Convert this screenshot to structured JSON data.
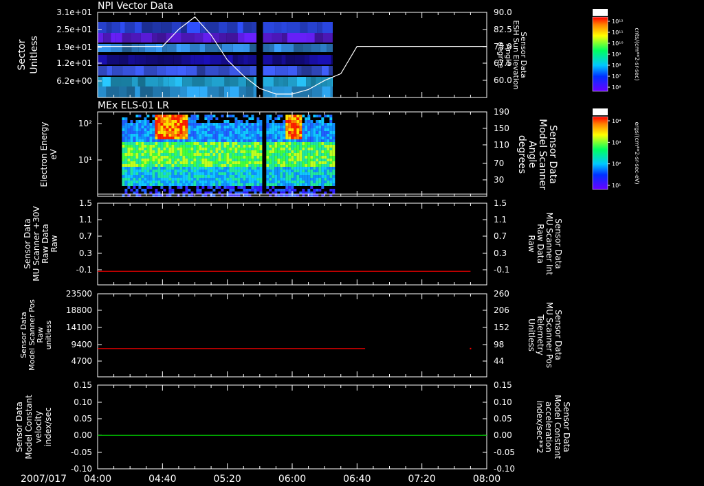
{
  "chart_data": [
    {
      "type": "heatmap",
      "title": "NPI Vector Data",
      "ylabel_left": [
        "Sector",
        "Unitless"
      ],
      "ylabel_right": [
        "Sensor Data",
        "ESH Sun Elevation",
        "Angle",
        "degree"
      ],
      "yticks_left": [
        "3.1e+01",
        "2.5e+01",
        "1.9e+01",
        "1.2e+01",
        "6.2e+00"
      ],
      "yticks_right": [
        "90.0",
        "82.5",
        "75.0",
        "67.5",
        "60.0"
      ],
      "ylim_right": [
        52.5,
        90
      ],
      "colorbar": {
        "label": "NF",
        "units": "cnts/(cm**2-sr-sec)",
        "ticks": [
          "10¹²",
          "10¹¹",
          "10¹⁰",
          "10⁹",
          "10⁸",
          "10⁷",
          "10⁶"
        ]
      },
      "overlay_line": {
        "x": [
          "04:00",
          "04:40",
          "04:50",
          "05:00",
          "05:10",
          "05:20",
          "05:30",
          "05:40",
          "05:50",
          "06:00",
          "06:10",
          "06:20",
          "06:30",
          "06:40",
          "07:00",
          "07:20",
          "07:40",
          "08:00"
        ],
        "y": [
          75.0,
          75.0,
          82.5,
          88.0,
          80.0,
          69.0,
          62.0,
          56.5,
          54.0,
          54.0,
          56.0,
          60.0,
          63.0,
          75.0,
          75.0,
          75.0,
          75.0,
          75.0
        ]
      },
      "data_gaps": [
        [
          "05:38",
          "05:42"
        ],
        [
          "06:25",
          "08:00"
        ]
      ]
    },
    {
      "type": "heatmap",
      "title": "MEx ELS-01 LR",
      "ylabel_left": [
        "Electron Energy",
        "eV"
      ],
      "ylabel_right": [
        "Sensor Data",
        "Model Scanner",
        "Angle",
        "degrees"
      ],
      "yticks_left": [
        "10²",
        "10¹"
      ],
      "yticks_right": [
        "190",
        "150",
        "110",
        "70",
        "30"
      ],
      "ylim_right": [
        0,
        190
      ],
      "colorbar": {
        "label": "DEF",
        "units": "ergs/(cm**2-sr-sec-eV)",
        "ticks": [
          "10⁴",
          "10³",
          "10²",
          "10¹"
        ]
      },
      "overlay_line": {
        "x": [
          "04:00",
          "08:00"
        ],
        "y": [
          5,
          5
        ]
      },
      "data_gaps": [
        [
          "05:40",
          "05:44"
        ],
        [
          "06:28",
          "08:00"
        ]
      ]
    },
    {
      "type": "line",
      "ylabel_left": [
        "Sensor Data",
        "MU Scanner +30V",
        "Raw Data",
        "Raw"
      ],
      "ylabel_right": [
        "Sensor Data",
        "MU Scanner Int",
        "Raw Data",
        "Raw"
      ],
      "yticks_left": [
        "1.5",
        "1.1",
        "0.7",
        "0.3",
        "-0.1"
      ],
      "yticks_right": [
        "1.5",
        "1.1",
        "0.7",
        "0.3",
        "-0.1"
      ],
      "ylim": [
        -0.3,
        1.5
      ],
      "series": [
        {
          "color": "#ff0000",
          "x": [
            "04:00",
            "07:50"
          ],
          "values": [
            0.0,
            0.0
          ]
        }
      ]
    },
    {
      "type": "line",
      "ylabel_left": [
        "Sensor Data",
        "Model Scanner Pos",
        "Raw",
        "unitless"
      ],
      "ylabel_right": [
        "Sensor Data",
        "MU Scanner Pos",
        "Telemetry",
        "Unitless"
      ],
      "yticks_left": [
        "23500",
        "18800",
        "14100",
        "9400",
        "4700"
      ],
      "yticks_right": [
        "260",
        "206",
        "152",
        "98",
        "44"
      ],
      "ylim": [
        0,
        23500
      ],
      "series": [
        {
          "color": "#ff0000",
          "x": [
            "04:00",
            "06:45"
          ],
          "values": [
            8000,
            8000
          ]
        }
      ]
    },
    {
      "type": "line",
      "ylabel_left": [
        "Sensor Data",
        "Model Constant",
        "velocity",
        "index/sec"
      ],
      "ylabel_right": [
        "Sensor Data",
        "Model Constant",
        "acceleration",
        "index/sec**2"
      ],
      "yticks_left": [
        "0.15",
        "0.10",
        "0.05",
        "0.00",
        "-0.05",
        "-0.10"
      ],
      "yticks_right": [
        "0.15",
        "0.10",
        "0.05",
        "0.00",
        "-0.05",
        "-0.10"
      ],
      "ylim": [
        -0.1,
        0.15
      ],
      "series": [
        {
          "color": "#00dd00",
          "x": [
            "04:00",
            "08:00"
          ],
          "values": [
            0.0,
            0.0
          ]
        }
      ]
    }
  ],
  "xaxis": {
    "date": "2007/017",
    "ticks": [
      "04:00",
      "04:40",
      "05:20",
      "06:00",
      "06:40",
      "07:20",
      "08:00"
    ],
    "xlim": [
      "04:00",
      "08:00"
    ]
  },
  "colors": {
    "right_label_red": "#ff0000",
    "right_label_green": "#00dd00"
  }
}
